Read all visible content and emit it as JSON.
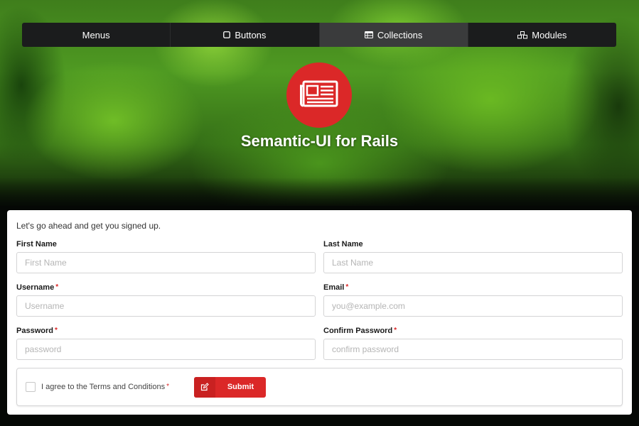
{
  "nav": {
    "items": [
      {
        "label": "Menus",
        "icon": "none",
        "active": false
      },
      {
        "label": "Buttons",
        "icon": "square-outline-icon",
        "active": false
      },
      {
        "label": "Collections",
        "icon": "table-icon",
        "active": true
      },
      {
        "label": "Modules",
        "icon": "cubes-icon",
        "active": false
      }
    ]
  },
  "hero": {
    "title": "Semantic-UI for Rails",
    "logo_icon": "newspaper-icon",
    "logo_color": "#db2828"
  },
  "form": {
    "intro": "Let's go ahead and get you signed up.",
    "first_name": {
      "label": "First Name",
      "placeholder": "First Name",
      "value": ""
    },
    "last_name": {
      "label": "Last Name",
      "placeholder": "Last Name",
      "value": ""
    },
    "username": {
      "label": "Username",
      "placeholder": "Username",
      "value": "",
      "required": "*"
    },
    "email": {
      "label": "Email",
      "placeholder": "you@example.com",
      "value": "",
      "required": "*"
    },
    "password": {
      "label": "Password",
      "placeholder": "password",
      "value": "",
      "required": "*"
    },
    "confirm_password": {
      "label": "Confirm Password",
      "placeholder": "confirm password",
      "value": "",
      "required": "*"
    },
    "terms": {
      "label": "I agree to the Terms and Conditions",
      "required": "*",
      "checked": false
    },
    "submit": {
      "label": "Submit",
      "icon": "edit-icon",
      "color": "#db2828"
    }
  }
}
